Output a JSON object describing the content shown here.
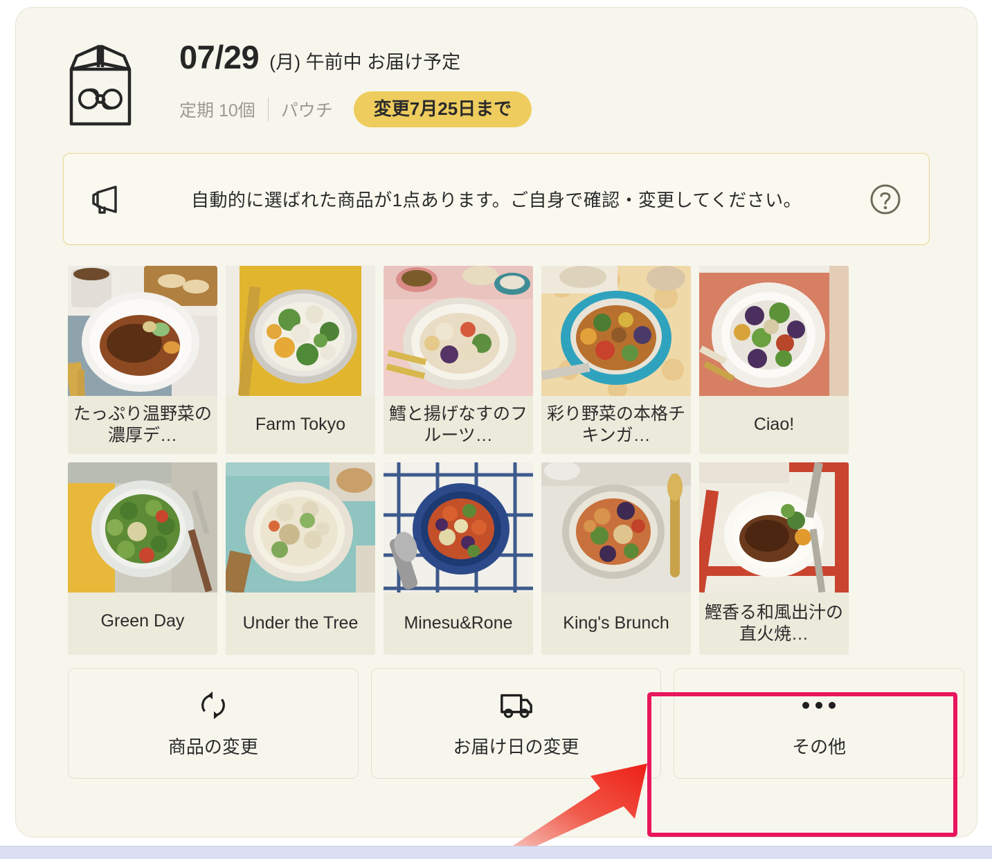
{
  "delivery": {
    "box_icon": "open-box-icon",
    "date": "07/29",
    "date_detail": "(月) 午前中 お届け予定",
    "plan": "定期 10個",
    "pack_type": "パウチ",
    "change_deadline_badge": "変更7月25日まで"
  },
  "notice": {
    "icon": "megaphone-icon",
    "message": "自動的に選ばれた商品が1点あります。ご自身で確認・変更してください。",
    "help_icon": "question-circle-icon"
  },
  "products": [
    {
      "name": "たっぷり温野菜の濃厚デ…",
      "image": "hamburg-steak-on-paper-plate"
    },
    {
      "name": "Farm Tokyo",
      "image": "cream-stew-yellow-mat"
    },
    {
      "name": "鱈と揚げなすのフルーツ…",
      "image": "cod-eggplant-fruit-sauce"
    },
    {
      "name": "彩り野菜の本格チキンガ…",
      "image": "chicken-curry-teal-bowl"
    },
    {
      "name": "Ciao!",
      "image": "eggplant-broccoli-pasta-white-plate"
    },
    {
      "name": "Green Day",
      "image": "green-vegetable-plate"
    },
    {
      "name": "Under the Tree",
      "image": "white-cream-soup-teal-mat"
    },
    {
      "name": "Minesu&Rone",
      "image": "minestrone-blue-bowl"
    },
    {
      "name": "King's Brunch",
      "image": "tomato-cream-curry-bowl"
    },
    {
      "name": "鰹香る和風出汁の直火焼…",
      "image": "hamburg-steak-red-check"
    }
  ],
  "actions": [
    {
      "icon": "refresh-icon",
      "label": "商品の変更"
    },
    {
      "icon": "truck-icon",
      "label": "お届け日の変更"
    },
    {
      "icon": "ellipsis-icon",
      "label": "その他"
    }
  ],
  "annotation": {
    "highlight_color": "#e8175d",
    "arrow_color": "#ef2222",
    "target": "その他"
  }
}
